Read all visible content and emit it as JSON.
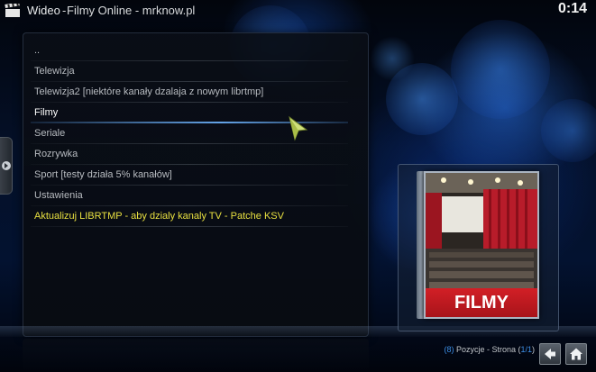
{
  "header": {
    "app_title": "Wideo",
    "separator": "-",
    "subtitle": "Filmy Online - mrknow.pl",
    "clock": "0:14"
  },
  "list": {
    "items": [
      {
        "label": "..",
        "state": "normal"
      },
      {
        "label": "Telewizja",
        "state": "normal"
      },
      {
        "label": "Telewizja2 [niektóre kanały dzalaja z nowym librtmp]",
        "state": "normal"
      },
      {
        "label": "Filmy",
        "state": "focused"
      },
      {
        "label": "Seriale",
        "state": "normal"
      },
      {
        "label": "Rozrywka",
        "state": "normal"
      },
      {
        "label": "Sport [testy działa 5% kanałów]",
        "state": "normal"
      },
      {
        "label": "Ustawienia",
        "state": "normal"
      },
      {
        "label": "Aktualizuj LIBRTMP - aby dzialy kanaly TV - Patche KSV",
        "state": "highlight"
      }
    ]
  },
  "thumbnail": {
    "banner_text": "FILMY"
  },
  "status": {
    "count_open": "(",
    "count": "8",
    "count_close": ")",
    "positions_label": " Pozycje - Strona ",
    "page_open": "(",
    "page": "1/1",
    "page_close": ")"
  },
  "icons": {
    "clapper": "clapperboard-icon",
    "cursor": "mouse-pointer-icon",
    "back": "back-arrow-icon",
    "home": "home-icon"
  },
  "colors": {
    "accent": "#3d8fe6",
    "highlight_text": "#e8e040",
    "banner_red": "#d21f26"
  }
}
